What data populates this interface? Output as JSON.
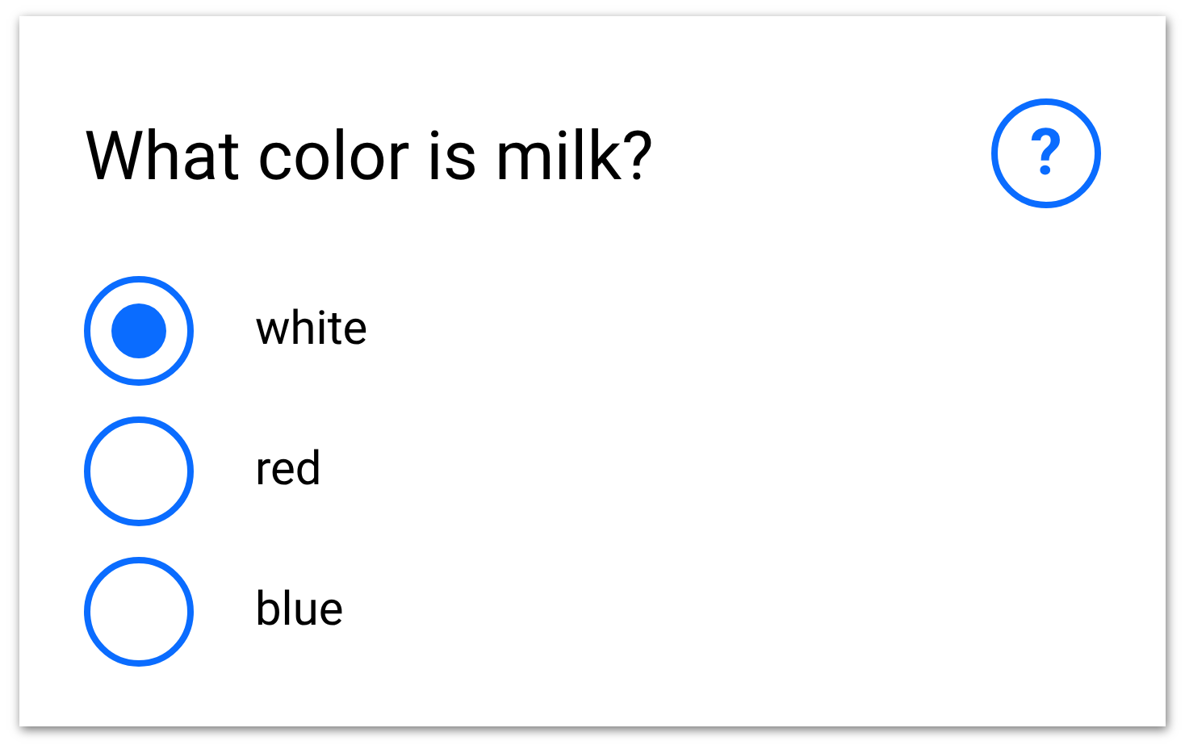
{
  "question": {
    "title": "What color is milk?",
    "help": "?"
  },
  "options": [
    {
      "label": "white",
      "selected": true
    },
    {
      "label": "red",
      "selected": false
    },
    {
      "label": "blue",
      "selected": false
    }
  ]
}
